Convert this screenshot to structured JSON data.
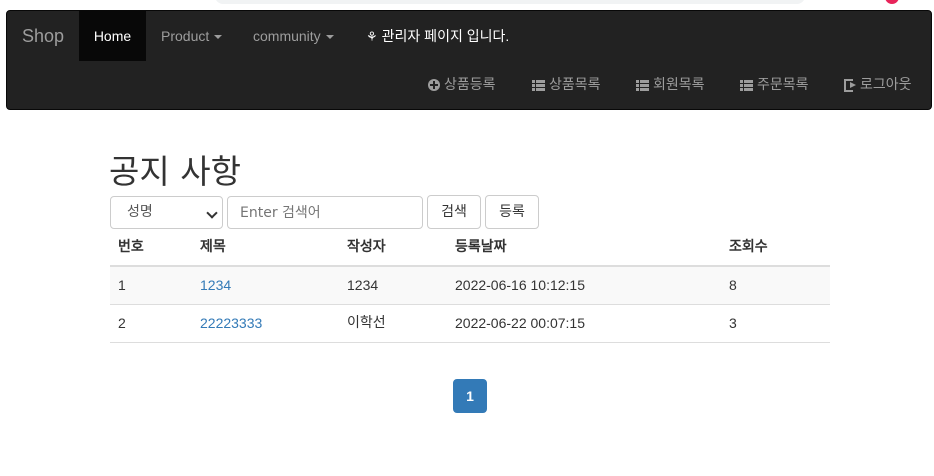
{
  "navbar": {
    "brand": "Shop",
    "home": "Home",
    "product": "Product",
    "community": "community",
    "admin_notice": "관리자 페이지 입니다.",
    "actions": {
      "product_register": "상품등록",
      "product_list": "상품목록",
      "member_list": "회원목록",
      "order_list": "주문목록",
      "logout": "로그아웃"
    }
  },
  "main": {
    "title": "공지 사항",
    "search": {
      "select_value": "성명",
      "input_placeholder": "Enter 검색어",
      "search_button": "검색",
      "register_button": "등록"
    },
    "table": {
      "headers": [
        "번호",
        "제목",
        "작성자",
        "등록날짜",
        "조회수"
      ],
      "rows": [
        {
          "no": "1",
          "title": "1234",
          "author": "1234",
          "date": "2022-06-16 10:12:15",
          "views": "8"
        },
        {
          "no": "2",
          "title": "22223333",
          "author": "이학선",
          "date": "2022-06-22 00:07:15",
          "views": "3"
        }
      ]
    },
    "pagination": {
      "current": "1"
    }
  },
  "colors": {
    "navbar_bg": "#222222",
    "link": "#337ab7",
    "pagination_active": "#337ab7"
  }
}
